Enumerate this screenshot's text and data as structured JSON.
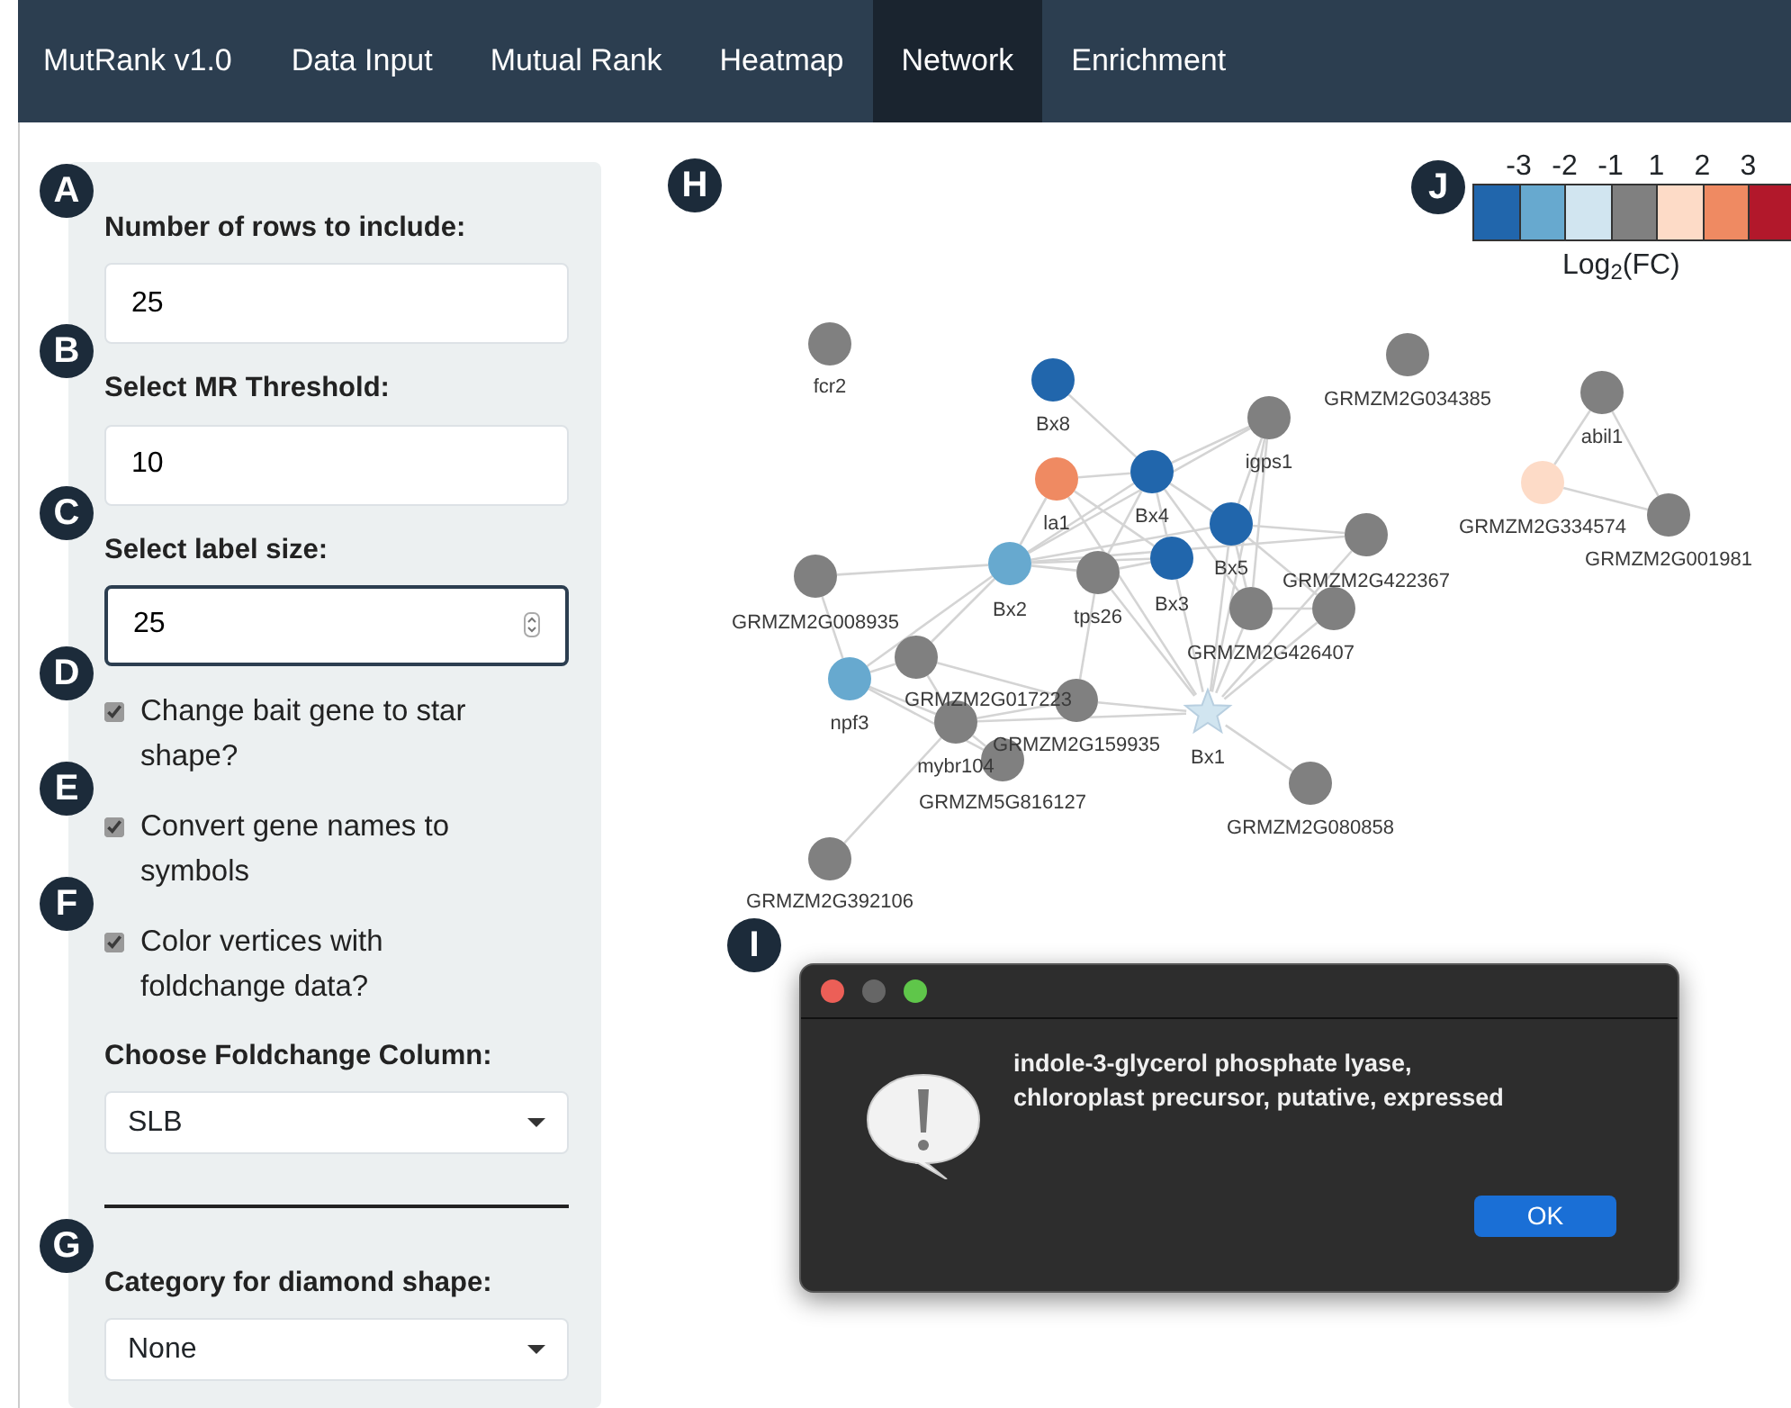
{
  "navbar": {
    "brand": "MutRank v1.0",
    "tabs": [
      {
        "label": "Data Input",
        "selected": false
      },
      {
        "label": "Mutual Rank",
        "selected": false
      },
      {
        "label": "Heatmap",
        "selected": false
      },
      {
        "label": "Network",
        "selected": true
      },
      {
        "label": "Enrichment",
        "selected": false
      }
    ]
  },
  "sidebar": {
    "controls": [
      {
        "kind": "text",
        "marker": "A",
        "label": "Number of rows to include:",
        "value": "25",
        "focused": false
      },
      {
        "kind": "text",
        "marker": "B",
        "label": "Select MR Threshold:",
        "value": "10",
        "focused": false
      },
      {
        "kind": "number",
        "marker": "C",
        "label": "Select label size:",
        "value": "25",
        "focused": true
      },
      {
        "kind": "checkbox",
        "marker": "D",
        "label": "Change bait gene to star shape?",
        "checked": true
      },
      {
        "kind": "checkbox",
        "marker": "E",
        "label": "Convert gene names to symbols",
        "checked": true
      },
      {
        "kind": "checkbox",
        "marker": "F",
        "label": "Color vertices with foldchange data?",
        "checked": true
      },
      {
        "kind": "select",
        "label": "Choose Foldchange Column:",
        "value": "SLB"
      },
      {
        "kind": "divider"
      },
      {
        "kind": "select",
        "marker": "G",
        "label": "Category for diamond shape:",
        "value": "None"
      }
    ]
  },
  "network": {
    "marker": "H",
    "nodes": [
      {
        "label": "fcr2",
        "color": "#808080",
        "kind": "circle"
      },
      {
        "label": "Bx8",
        "color": "#2166ac",
        "kind": "circle"
      },
      {
        "label": "GRMZM2G034385",
        "color": "#808080",
        "kind": "circle"
      },
      {
        "label": "abil1",
        "color": "#808080",
        "kind": "circle"
      },
      {
        "label": "igps1",
        "color": "#808080",
        "kind": "circle"
      },
      {
        "label": "la1",
        "color": "#ef8a62",
        "kind": "circle"
      },
      {
        "label": "Bx4",
        "color": "#2166ac",
        "kind": "circle"
      },
      {
        "label": "GRMZM2G334574",
        "color": "#fddbc7",
        "kind": "circle"
      },
      {
        "label": "GRMZM2G001981",
        "color": "#808080",
        "kind": "circle"
      },
      {
        "label": "Bx5",
        "color": "#2166ac",
        "kind": "circle"
      },
      {
        "label": "GRMZM2G422367",
        "color": "#808080",
        "kind": "circle"
      },
      {
        "label": "Bx2",
        "color": "#67a9cf",
        "kind": "circle"
      },
      {
        "label": "tps26",
        "color": "#808080",
        "kind": "circle"
      },
      {
        "label": "Bx3",
        "color": "#2166ac",
        "kind": "circle"
      },
      {
        "label": "GRMZM2G008935",
        "color": "#808080",
        "kind": "circle"
      },
      {
        "color": "#808080",
        "kind": "circle"
      },
      {
        "label": "GRMZM2G426407",
        "color": "#808080",
        "kind": "circle"
      },
      {
        "label": "GRMZM2G017223",
        "color": "#808080",
        "kind": "circle"
      },
      {
        "label": "npf3",
        "color": "#67a9cf",
        "kind": "circle"
      },
      {
        "label": "GRMZM2G159935",
        "color": "#808080",
        "kind": "circle"
      },
      {
        "label": "mybr104",
        "color": "#808080",
        "kind": "circle"
      },
      {
        "label": "GRMZM5G816127",
        "color": "#808080",
        "kind": "circle"
      },
      {
        "label": "Bx1",
        "color": "#d1e5f0",
        "kind": "star"
      },
      {
        "label": "GRMZM2G080858",
        "color": "#808080",
        "kind": "circle"
      },
      {
        "label": "GRMZM2G392106",
        "color": "#808080",
        "kind": "circle"
      }
    ]
  },
  "legend": {
    "marker": "J",
    "ticks": [
      "-3",
      "-2",
      "-1",
      "1",
      "2",
      "3"
    ],
    "swatches": [
      {
        "color": "#2166ac"
      },
      {
        "color": "#67a9cf"
      },
      {
        "color": "#d1e5f0"
      },
      {
        "color": "#808080"
      },
      {
        "color": "#fddbc7"
      },
      {
        "color": "#ef8a62"
      },
      {
        "color": "#b2182b"
      }
    ],
    "title": "Log$_{2}$(FC)"
  },
  "dialog": {
    "marker": "I",
    "message": "indole-3-glycerol phosphate lyase, chloroplast precursor, putative, expressed",
    "button": "OK"
  }
}
